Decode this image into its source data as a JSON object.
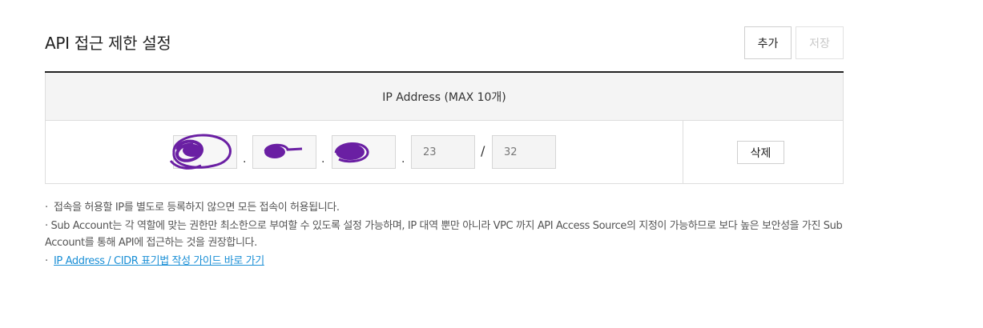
{
  "header": {
    "title": "API 접근 제한 설정",
    "add_label": "추가",
    "save_label": "저장"
  },
  "table": {
    "column_header": "IP Address (MAX 10개)",
    "rows": [
      {
        "octets": [
          "",
          "",
          "",
          "23"
        ],
        "prefix": "32",
        "dot": ".",
        "slash": "/",
        "delete_label": "삭제"
      }
    ]
  },
  "notes": {
    "bullet": "·",
    "items": [
      "접속을 허용할 IP를 별도로 등록하지 않으면 모든 접속이 허용됩니다.",
      "Sub Account는 각 역할에 맞는 권한만 최소한으로 부여할 수 있도록 설정 가능하며, IP 대역 뿐만 아니라 VPC 까지 API Access Source의 지정이 가능하므로 보다 높은 보안성을 가진 Sub Account를 통해 API에 접근하는 것을 권장합니다."
    ],
    "link_label": "IP Address / CIDR 표기법 작성 가이드 바로 가기"
  },
  "colors": {
    "accent_link": "#1a8fd6",
    "scribble": "#6a1fa3",
    "header_border": "#222222",
    "disabled_text": "#c8c8c8"
  }
}
